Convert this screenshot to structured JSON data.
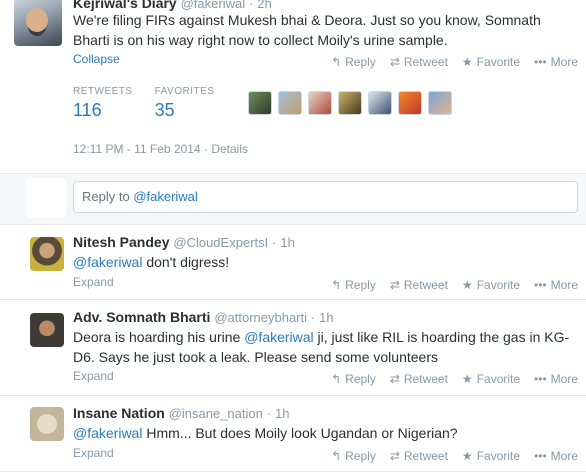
{
  "main_tweet": {
    "fullname": "Kejriwal's Diary",
    "username": "@fakeriwal",
    "time": "2h",
    "text": "We're filing FIRs against Mukesh bhai & Deora. Just so you know, Somnath Bharti is on his way right now to collect Moily's urine sample.",
    "collapse_label": "Collapse",
    "actions": {
      "reply": "Reply",
      "retweet": "Retweet",
      "favorite": "Favorite",
      "more": "More"
    },
    "stats": {
      "retweets_label": "RETWEETS",
      "retweets_count": "116",
      "favorites_label": "FAVORITES",
      "favorites_count": "35"
    },
    "timestamp": "12:11 PM - 11 Feb 2014",
    "details_label": "Details",
    "separator": "·"
  },
  "reply_box": {
    "placeholder_prefix": "Reply to ",
    "mention": "@fakeriwal"
  },
  "replies": [
    {
      "fullname": "Nitesh Pandey",
      "username": "@CloudExpertsI",
      "time": "1h",
      "mention": "@fakeriwal",
      "text_before": "",
      "text_after": " don't digress!",
      "expand": "Expand"
    },
    {
      "fullname": "Adv. Somnath Bharti",
      "username": "@attorneybharti",
      "time": "1h",
      "mention": "@fakeriwal",
      "text_before": "Deora is hoarding his urine ",
      "text_after": " ji, just like RIL is hoarding the gas in KG-D6. Says he just took a leak. Please send some volunteers",
      "expand": "Expand"
    },
    {
      "fullname": "Insane Nation",
      "username": "@insane_nation",
      "time": "1h",
      "mention": "@fakeriwal",
      "text_before": "",
      "text_after": " Hmm... But does Moily look Ugandan or Nigerian?",
      "expand": "Expand"
    }
  ],
  "icons": {
    "reply": "reply-icon",
    "retweet": "retweet-icon",
    "favorite": "star-icon",
    "more": "ellipsis-icon"
  },
  "colors": {
    "link": "#2b7bb9",
    "muted": "#8899a6",
    "text": "#292f33"
  }
}
